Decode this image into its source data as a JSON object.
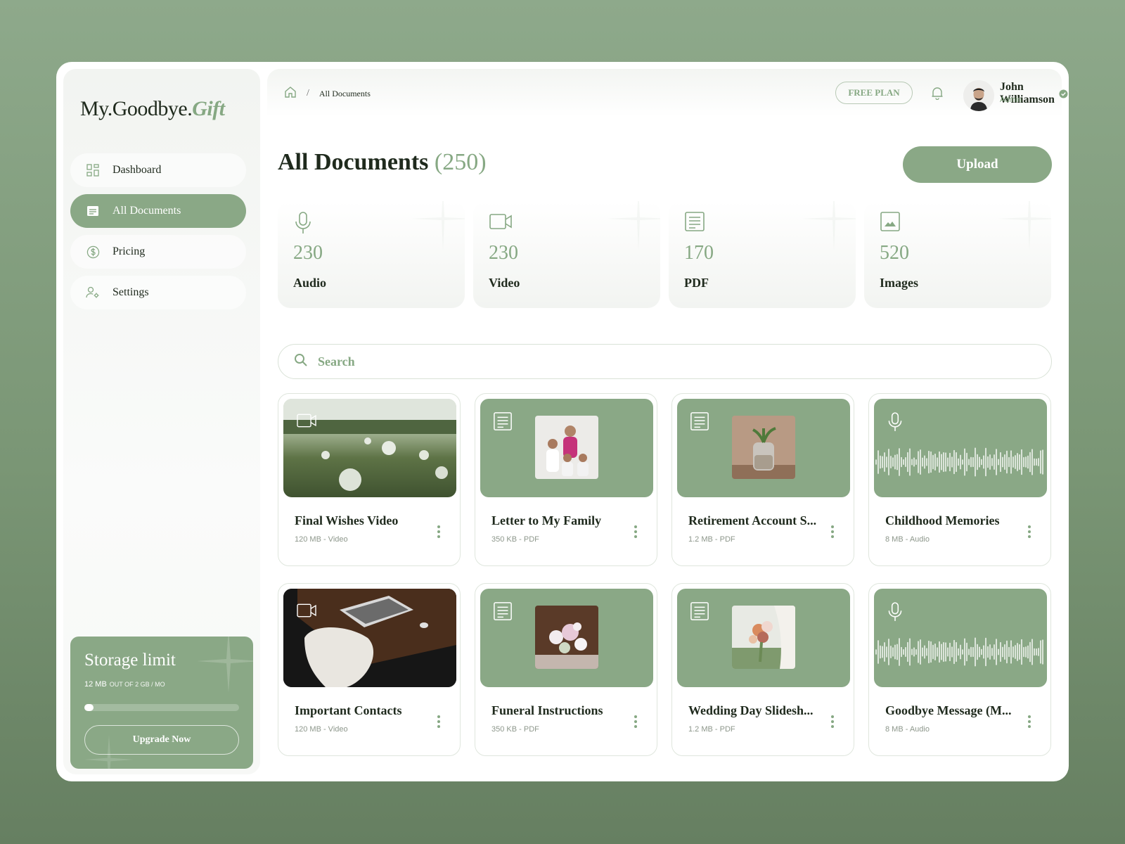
{
  "colors": {
    "accent": "#86a883",
    "accent_fill": "#8aa886",
    "text": "#1f2a1d",
    "page_bg": "#7a9675"
  },
  "brand": {
    "name_main": "My.Goodbye.",
    "name_accent": "Gift"
  },
  "sidebar": {
    "items": [
      {
        "label": "Dashboard",
        "icon": "grid-icon",
        "active": false
      },
      {
        "label": "All Documents",
        "icon": "document-icon",
        "active": true
      },
      {
        "label": "Pricing",
        "icon": "dollar-circle-icon",
        "active": false
      },
      {
        "label": "Settings",
        "icon": "user-gear-icon",
        "active": false
      }
    ],
    "storage": {
      "title": "Storage limit",
      "used": "12 MB",
      "total": "OUT OF 2 GB / MO",
      "usage_fraction": 0.06,
      "upgrade_label": "Upgrade Now"
    }
  },
  "header": {
    "breadcrumb": [
      "All Documents"
    ],
    "plan": "FREE PLAN",
    "user": {
      "name": "John Williamson",
      "role": "Admin"
    }
  },
  "main": {
    "title": "All Documents",
    "count": "(250)",
    "upload_label": "Upload",
    "stats": [
      {
        "value": "230",
        "label": "Audio",
        "icon": "microphone-icon"
      },
      {
        "value": "230",
        "label": "Video",
        "icon": "video-camera-icon"
      },
      {
        "value": "170",
        "label": "PDF",
        "icon": "document-icon"
      },
      {
        "value": "520",
        "label": "Images",
        "icon": "image-icon"
      }
    ],
    "search_placeholder": "Search",
    "documents": [
      {
        "title": "Final Wishes Video",
        "meta": "120 MB - Video",
        "type": "video"
      },
      {
        "title": "Letter to My Family",
        "meta": "350 KB - PDF",
        "type": "pdf"
      },
      {
        "title": "Retirement Account S...",
        "meta": "1.2 MB - PDF",
        "type": "pdf"
      },
      {
        "title": "Childhood Memories",
        "meta": "8 MB - Audio",
        "type": "audio"
      },
      {
        "title": "Important Contacts",
        "meta": "120 MB - Video",
        "type": "video"
      },
      {
        "title": "Funeral Instructions",
        "meta": "350 KB - PDF",
        "type": "pdf"
      },
      {
        "title": "Wedding Day Slidesh...",
        "meta": "1.2 MB - PDF",
        "type": "pdf"
      },
      {
        "title": "Goodbye Message (M...",
        "meta": "8 MB - Audio",
        "type": "audio"
      }
    ]
  }
}
